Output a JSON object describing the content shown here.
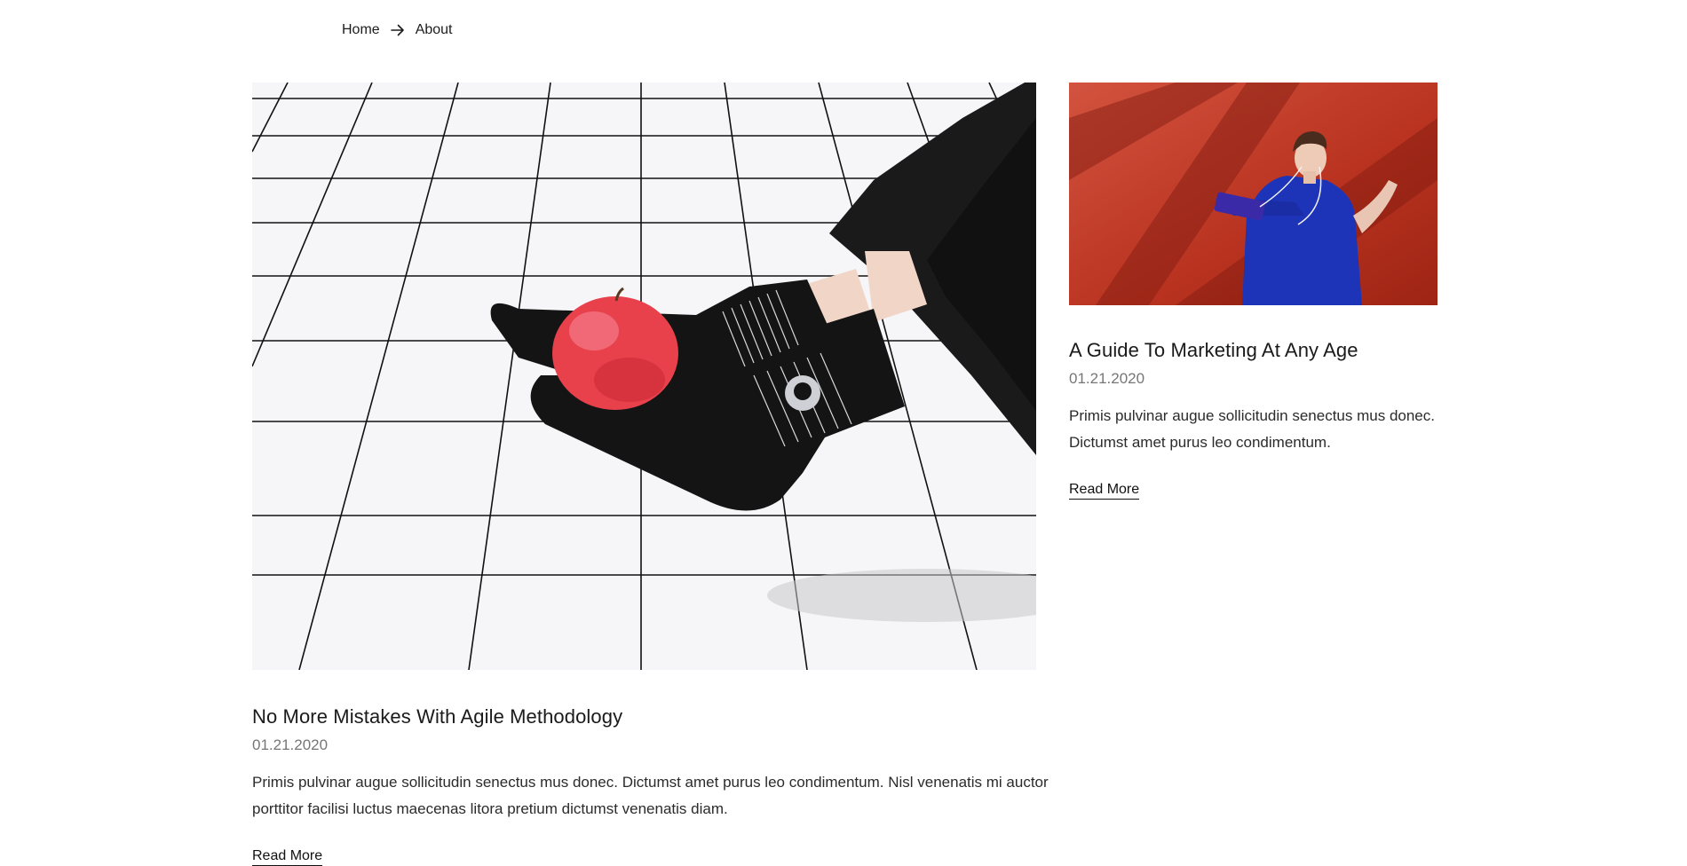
{
  "breadcrumb": {
    "home_label": "Home",
    "current_label": "About",
    "separator_icon": "arrow-right-icon"
  },
  "posts": [
    {
      "title": "No More Mistakes With Agile Methodology",
      "date": "01.21.2020",
      "excerpt": "Primis pulvinar augue sollicitudin senectus mus donec. Dictumst amet purus leo condimentum. Nisl venenatis mi auctor porttitor facilisi luctus maecenas litora pretium dictumst venenatis diam.",
      "read_more_label": "Read More",
      "image_alt": "Feet in black socks holding a red apple on a grid floor"
    },
    {
      "title": "A Guide To Marketing At Any Age",
      "date": "01.21.2020",
      "excerpt": "Primis pulvinar augue sollicitudin senectus mus donec. Dictumst amet purus leo condimentum.",
      "read_more_label": "Read More",
      "image_alt": "Woman in blue shirt with earphones and phone against red background"
    }
  ],
  "colors": {
    "text": "#1a1a1a",
    "date": "#767676",
    "apple": "#e8414c",
    "red_background": "#c93f2e",
    "blue_shirt": "#1d34b8"
  }
}
